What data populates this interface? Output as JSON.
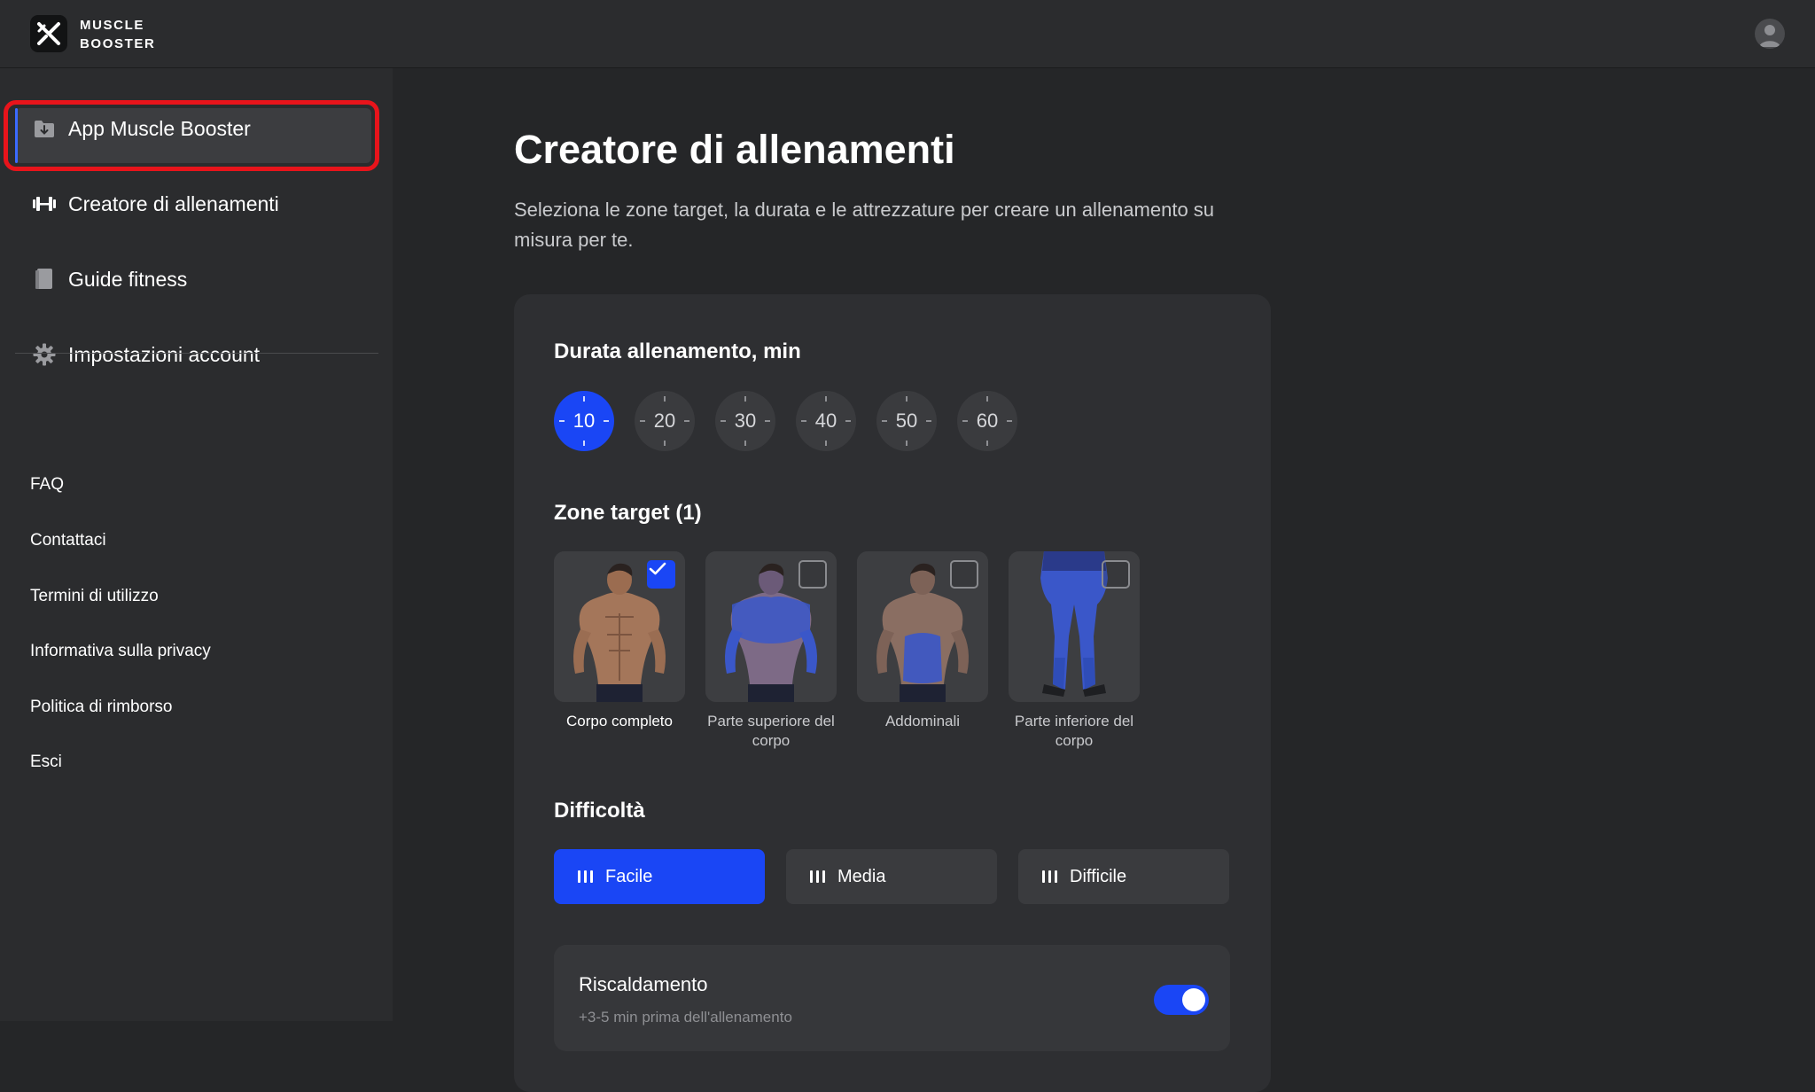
{
  "brand": {
    "line1": "MUSCLE",
    "line2": "BOOSTER"
  },
  "sidebar": {
    "items": [
      {
        "label": "App Muscle Booster",
        "icon": "app-download-icon"
      },
      {
        "label": "Creatore di allenamenti",
        "icon": "dumbbell-icon",
        "active": true
      },
      {
        "label": "Guide fitness",
        "icon": "book-icon"
      },
      {
        "label": "Impostazioni account",
        "icon": "gear-icon"
      }
    ],
    "links": [
      "FAQ",
      "Contattaci",
      "Termini di utilizzo",
      "Informativa sulla privacy",
      "Politica di rimborso",
      "Esci"
    ]
  },
  "main": {
    "title": "Creatore di allenamenti",
    "subtitle": "Seleziona le zone target, la durata e le attrezzature per creare un allenamento su misura per te.",
    "duration": {
      "title": "Durata allenamento, min",
      "options": [
        "10",
        "20",
        "30",
        "40",
        "50",
        "60"
      ],
      "selected": "10"
    },
    "zones": {
      "title": "Zone target (1)",
      "items": [
        {
          "label": "Corpo completo",
          "checked": true
        },
        {
          "label": "Parte superiore del corpo",
          "checked": false
        },
        {
          "label": "Addominali",
          "checked": false
        },
        {
          "label": "Parte inferiore del corpo",
          "checked": false
        }
      ]
    },
    "difficulty": {
      "title": "Difficoltà",
      "options": [
        "Facile",
        "Media",
        "Difficile"
      ],
      "selected": "Facile"
    },
    "warmup": {
      "title": "Riscaldamento",
      "subtitle": "+3-5 min prima dell'allenamento",
      "enabled": true
    }
  },
  "colors": {
    "accent": "#1a46f5",
    "highlight": "#e8141b"
  }
}
